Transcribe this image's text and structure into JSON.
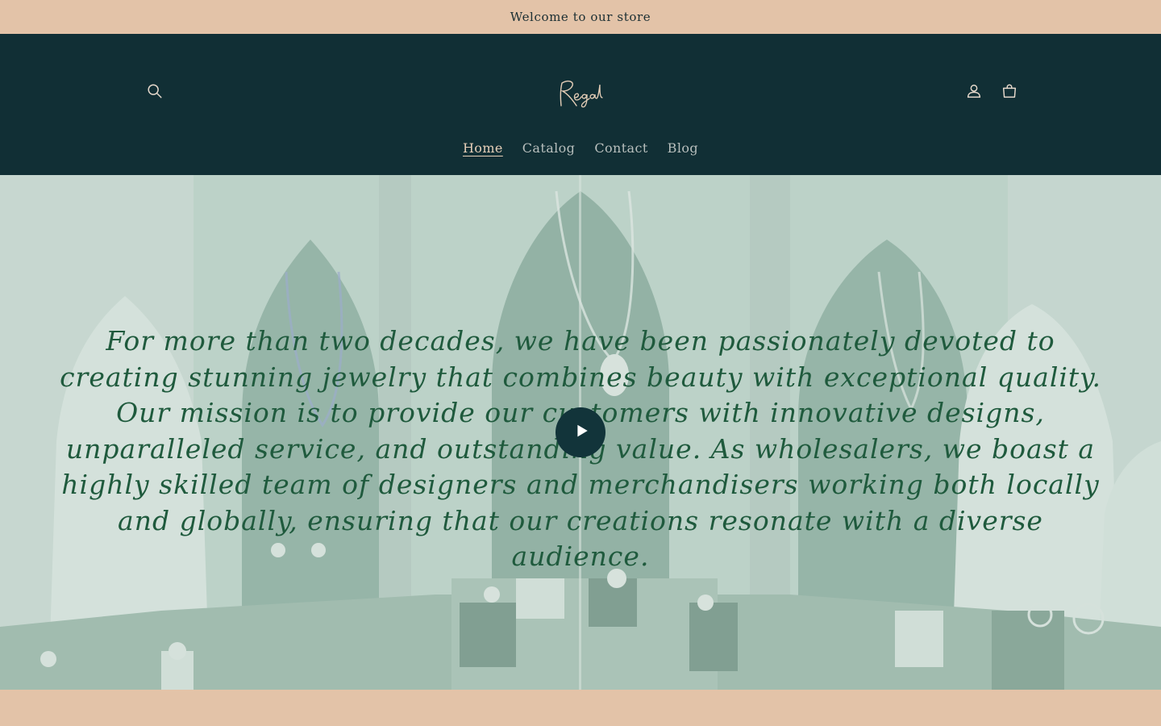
{
  "announcement": {
    "text": "Welcome to our store"
  },
  "header": {
    "logo_text": "Regal",
    "icons": {
      "search": "search-icon",
      "account": "account-icon",
      "cart": "cart-icon"
    },
    "nav": [
      {
        "label": "Home",
        "active": true
      },
      {
        "label": "Catalog",
        "active": false
      },
      {
        "label": "Contact",
        "active": false
      },
      {
        "label": "Blog",
        "active": false
      }
    ]
  },
  "hero": {
    "text": "For more than two decades, we have been passionately devoted to creating stunning jewelry that combines beauty with exceptional quality. Our mission is to provide our customers with innovative designs, unparalleled service, and outstanding value. As wholesalers, we boast a highly skilled team of designers and merchandisers working both locally and globally, ensuring that our creations resonate with a diverse audience.",
    "play_icon": "play-icon"
  },
  "colors": {
    "announcement_bg": "#e3c3a8",
    "header_bg": "#112f35",
    "nav_active": "#e6cfb8",
    "nav_inactive": "#b8bfbd",
    "hero_text": "#1f5a3d",
    "hero_overlay": "#b7cdc3",
    "play_button": "#12343a"
  }
}
